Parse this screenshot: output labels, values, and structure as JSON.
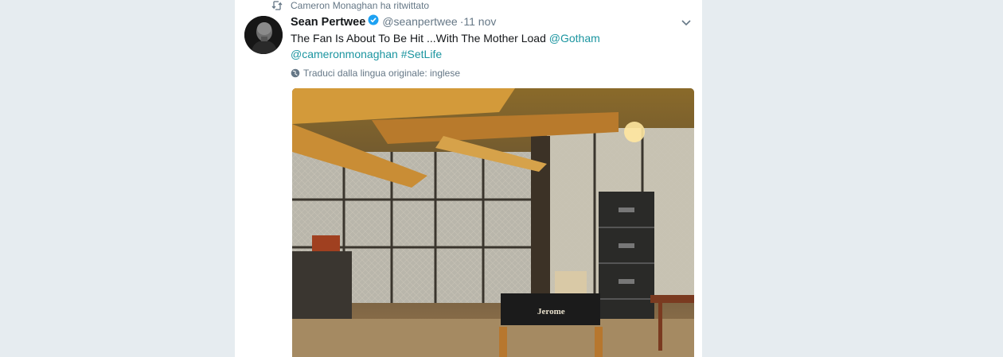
{
  "retweet": {
    "text": "Cameron Monaghan ha ritwittato",
    "icon": "retweet-icon"
  },
  "tweet": {
    "author_name": "Sean Pertwee",
    "handle": "@seanpertwee",
    "timestamp": "·11 nov",
    "text_plain": "The Fan Is About To Be Hit ...With The Mother Load ",
    "mention_gotham": "@Gotham",
    "mention_cameron": "@cameronmonaghan",
    "hashtag": "#SetLife",
    "translate_label": "Traduci dalla lingua originale: inglese",
    "media_chair_label": "Jerome"
  },
  "colors": {
    "link": "#1b95a0",
    "text": "#14171a",
    "muted": "#657786",
    "verified": "#1da1f2",
    "background": "#e6ecf0"
  }
}
